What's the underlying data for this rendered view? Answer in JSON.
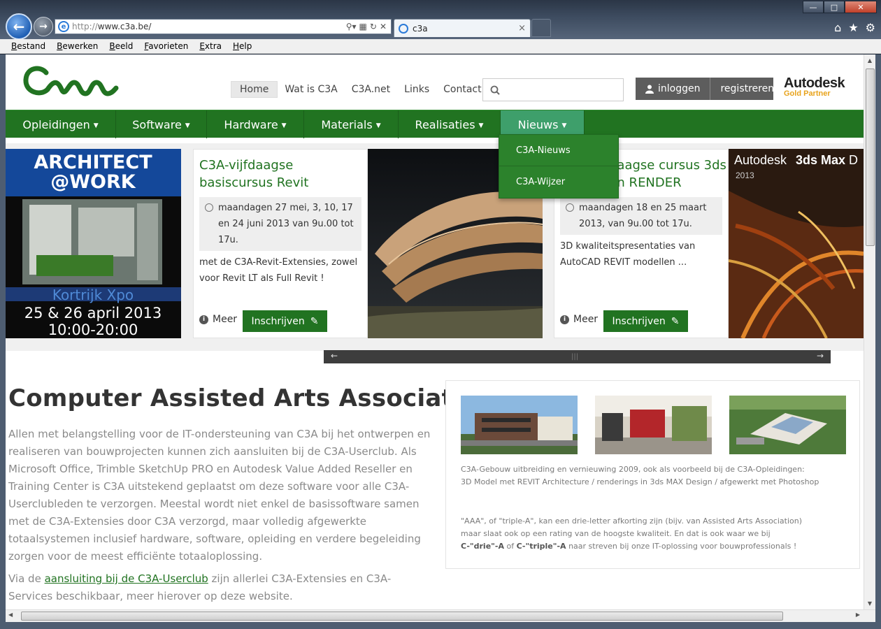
{
  "browser": {
    "url_prefix": "http://",
    "url_host": "www.c3a.be",
    "url_suffix": "/",
    "tab_title": "c3a",
    "tab_close": "×",
    "menu": [
      "Bestand",
      "Bewerken",
      "Beeld",
      "Favorieten",
      "Extra",
      "Help"
    ]
  },
  "header": {
    "topnav": [
      {
        "label": "Home",
        "active": true
      },
      {
        "label": "Wat is C3A",
        "active": false
      },
      {
        "label": "C3A.net",
        "active": false
      },
      {
        "label": "Links",
        "active": false
      },
      {
        "label": "Contact",
        "active": false
      }
    ],
    "search_placeholder": "",
    "login_label": "inloggen",
    "register_label": "registreren",
    "partner_name": "Autodesk",
    "partner_level": "Gold Partner"
  },
  "mainnav": {
    "items": [
      {
        "label": "Opleidingen",
        "active": false
      },
      {
        "label": "Software",
        "active": false
      },
      {
        "label": "Hardware",
        "active": false
      },
      {
        "label": "Materials",
        "active": false
      },
      {
        "label": "Realisaties",
        "active": false
      },
      {
        "label": "Nieuws",
        "active": true
      }
    ],
    "dropdown": [
      "C3A-Nieuws",
      "C3A-Wijzer"
    ]
  },
  "slider": {
    "banner": {
      "line1": "ARCHITECT",
      "line2": "@WORK",
      "line3": "Kortrijk Xpo",
      "line4": "25 & 26 april 2013",
      "line5": "10:00-20:00"
    },
    "cards": [
      {
        "title": "C3A-vijfdaagse basiscursus Revit",
        "date": "maandagen 27 mei, 3, 10, 17 en 24 juni 2013 van 9u.00 tot 17u.",
        "desc": "met de C3A-Revit-Extensies, zowel voor Revit LT als Full Revit !",
        "more": "Meer",
        "button": "Inschrijven"
      },
      {
        "title": "daagse cursus 3ds gn RENDER",
        "date": "maandagen 18 en 25 maart 2013, van 9u.00 tot 17u.",
        "desc": "3D kwaliteitspresentaties van AutoCAD REVIT modellen ...",
        "more": "Meer",
        "button": "Inschrijven"
      }
    ],
    "product_banner": {
      "brand": "Autodesk",
      "product": "3ds Max",
      "suffix": "D",
      "year": "2013"
    },
    "prev": "←",
    "next": "→"
  },
  "content": {
    "title": "Computer Assisted Arts Association",
    "paragraph": "Allen met belangstelling voor de IT-ondersteuning van C3A bij het ontwerpen en realiseren van bouwprojecten kunnen zich aansluiten bij de C3A-Userclub. Als Microsoft Office, Trimble SketchUp PRO en Autodesk Value Added Reseller en Training Center is C3A uitstekend geplaatst om deze software voor alle C3A-Userclubleden te verzorgen. Meestal wordt niet enkel de basissoftware samen met de C3A-Extensies door C3A verzorgd, maar volledig afgewerkte totaalsystemen inclusief hardware, software, opleiding en verdere begeleiding zorgen voor de meest efficiënte totaaloplossing.",
    "paragraph2_before": "Via de ",
    "paragraph2_link": "aansluiting bij de C3A-Userclub",
    "paragraph2_after": " zijn allerlei C3A-Extensies en C3A-Services beschikbaar, meer hierover op deze website."
  },
  "sidebox": {
    "caption_line1": "C3A-Gebouw uitbreiding en vernieuwing 2009, ook als voorbeeld bij de C3A-Opleidingen:",
    "caption_line2": "3D Model met REVIT Architecture / renderings in 3ds MAX Design / afgewerkt met Photoshop",
    "aaa_line1": "\"AAA\", of \"triple-A\", kan een drie-letter afkorting zijn (bijv. van Assisted Arts Association)",
    "aaa_line2": "maar slaat ook op een rating van de hoogste kwaliteit. En dat is ook waar we bij",
    "aaa_bold1": "C-\"drie\"-A",
    "aaa_of": " of ",
    "aaa_bold2": "C-\"triple\"-A",
    "aaa_rest": " naar streven bij onze IT-oplossing voor bouwprofessionals !"
  },
  "colors": {
    "brand_green": "#217321",
    "active_nav": "#3e9f6b",
    "autodesk_gold": "#e8a31c"
  }
}
